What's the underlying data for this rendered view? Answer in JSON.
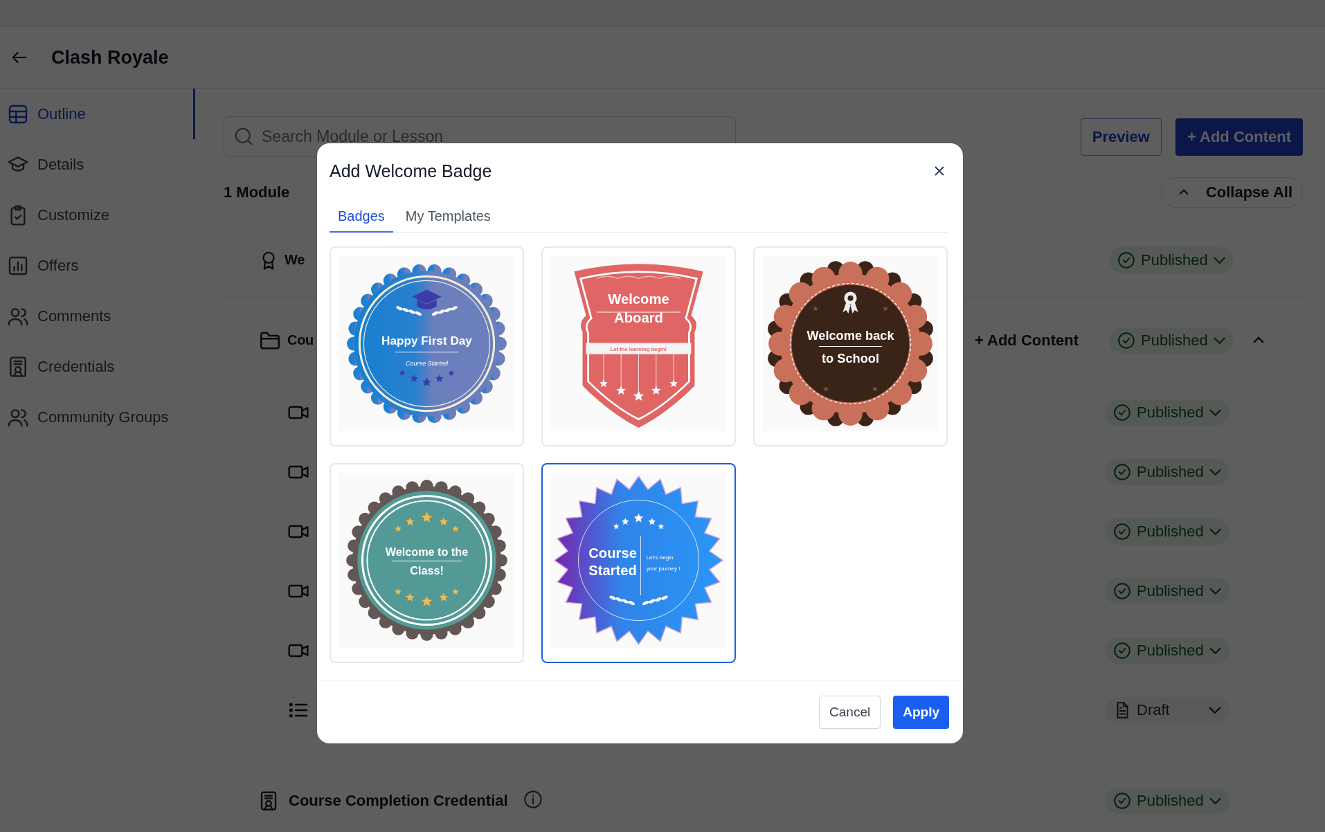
{
  "header": {
    "title": "Clash Royale"
  },
  "sidebar": {
    "items": [
      {
        "label": "Outline",
        "selected": true
      },
      {
        "label": "Details",
        "selected": false
      },
      {
        "label": "Customize",
        "selected": false
      },
      {
        "label": "Offers",
        "selected": false
      },
      {
        "label": "Comments",
        "selected": false
      },
      {
        "label": "Credentials",
        "selected": false
      },
      {
        "label": "Community Groups",
        "selected": false
      }
    ]
  },
  "toolbar": {
    "search_placeholder": "Search Module or Lesson",
    "preview_button": "Preview",
    "add_button": "+ Add Content"
  },
  "outline": {
    "module_count": "1 Module",
    "collapse_button": "Collapse All",
    "rows": [
      {
        "kind": "badge",
        "label": "We",
        "status": {
          "kind": "published",
          "label": "Published"
        }
      },
      {
        "kind": "folder",
        "label": "Cou",
        "action": "+ Add Content",
        "expanded": true,
        "status": {
          "kind": "published",
          "label": "Published"
        },
        "children": [
          {
            "kind": "video",
            "status": {
              "kind": "published",
              "label": "Published"
            }
          },
          {
            "kind": "video",
            "status": {
              "kind": "published",
              "label": "Published"
            }
          },
          {
            "kind": "video",
            "status": {
              "kind": "published",
              "label": "Published"
            }
          },
          {
            "kind": "video",
            "status": {
              "kind": "published",
              "label": "Published"
            }
          },
          {
            "kind": "video",
            "status": {
              "kind": "published",
              "label": "Published"
            }
          },
          {
            "kind": "quiz",
            "status": {
              "kind": "draft",
              "label": "Draft"
            }
          }
        ]
      },
      {
        "kind": "credential",
        "label": "Course Completion Credential",
        "status": {
          "kind": "published",
          "label": "Published"
        }
      }
    ]
  },
  "modal": {
    "title": "Add Welcome Badge",
    "tabs": [
      {
        "label": "Badges",
        "selected": true
      },
      {
        "label": "My Templates",
        "selected": false
      }
    ],
    "badges": [
      {
        "kind": "scallop",
        "lines": [
          "Happy First Day"
        ],
        "subtitle": "Course Started",
        "selected": false
      },
      {
        "kind": "shield",
        "lines": [
          "Welcome",
          "Aboard"
        ],
        "subtitle": "Let the learning begin!",
        "selected": false
      },
      {
        "kind": "flower",
        "lines": [
          "Welcome back",
          "to School"
        ],
        "selected": false
      },
      {
        "kind": "seal",
        "lines": [
          "Welcome to the",
          "Class!"
        ],
        "selected": false
      },
      {
        "kind": "starburst",
        "lines": [
          "Course",
          "Started"
        ],
        "side_lines": [
          "Let's begin",
          "your journey !"
        ],
        "selected": true
      }
    ],
    "cancel_button": "Cancel",
    "apply_button": "Apply"
  }
}
